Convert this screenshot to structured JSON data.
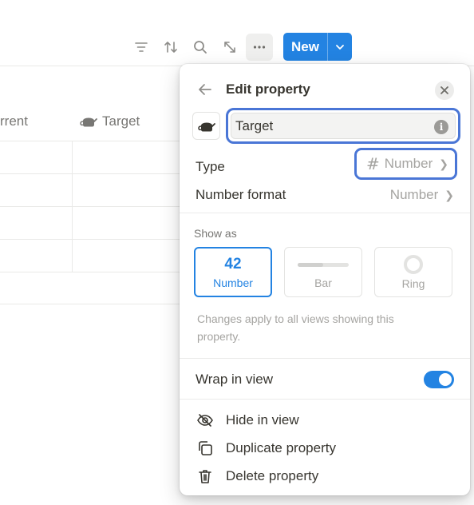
{
  "toolbar": {
    "icons": [
      "filter-icon",
      "sort-icon",
      "search-icon",
      "expand-icon",
      "more-icon"
    ],
    "new_label": "New",
    "new_dropdown_icon": "chevron-down-icon"
  },
  "table": {
    "columns": [
      {
        "label": "rrent"
      },
      {
        "label": "Target",
        "icon": "teapot-icon"
      }
    ]
  },
  "panel": {
    "title": "Edit property",
    "name_value": "Target",
    "type_label": "Type",
    "type_value": "Number",
    "format_label": "Number format",
    "format_value": "Number",
    "show_as_label": "Show as",
    "show_options": [
      {
        "preview": "42",
        "label": "Number",
        "selected": true
      },
      {
        "label": "Bar",
        "selected": false
      },
      {
        "label": "Ring",
        "selected": false
      }
    ],
    "note": "Changes apply to all views showing this property.",
    "wrap_label": "Wrap in view",
    "wrap_enabled": true,
    "actions": [
      {
        "label": "Hide in view",
        "icon": "eye-slash-icon"
      },
      {
        "label": "Duplicate property",
        "icon": "duplicate-icon"
      },
      {
        "label": "Delete property",
        "icon": "trash-icon"
      }
    ]
  },
  "colors": {
    "accent": "#2383e2",
    "highlight_outline": "#4a76d6",
    "text_primary": "#37352f",
    "text_muted": "#a5a4a1"
  }
}
